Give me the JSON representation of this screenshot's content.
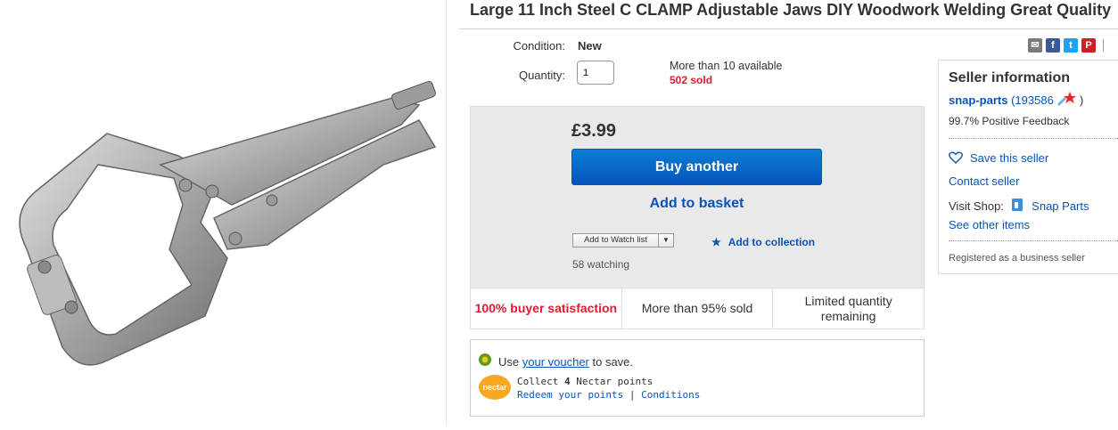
{
  "product": {
    "title": "Large 11 Inch Steel C CLAMP Adjustable Jaws DIY Woodwork Welding Great Quality"
  },
  "details": {
    "condition_label": "Condition:",
    "condition_value": "New",
    "quantity_label": "Quantity:",
    "quantity_value": "1",
    "availability": "More than 10 available",
    "sold": "502 sold"
  },
  "buybox": {
    "price": "£3.99",
    "buy_label": "Buy another",
    "basket_label": "Add to basket",
    "watch_label": "Add to Watch list",
    "collection_label": "Add to collection",
    "watching": "58 watching"
  },
  "stats": {
    "satisfaction": "100% buyer satisfaction",
    "sold_pct": "More than 95% sold",
    "limited": "Limited quantity remaining"
  },
  "voucher": {
    "use": "Use ",
    "link": "your voucher",
    "suffix": " to save.",
    "nectar_logo": "nectar",
    "collect_prefix": "Collect ",
    "points": "4",
    "collect_suffix": " Nectar points",
    "redeem": "Redeem your points",
    "sep": " | ",
    "conditions": "Conditions"
  },
  "seller": {
    "title": "Seller information",
    "name": "snap-parts",
    "rating_open": " (",
    "rating": "193586",
    "rating_close": " )",
    "feedback": "99.7% Positive Feedback",
    "save": "Save this seller",
    "contact": "Contact seller",
    "visit_label": "Visit Shop:",
    "shop_name": "Snap Parts",
    "other_items": "See other items",
    "registered": "Registered as a business seller"
  },
  "share": {
    "icons": [
      "mail-icon",
      "facebook-icon",
      "twitter-icon",
      "pinterest-icon"
    ],
    "colors": {
      "mail": "#7a7a7a",
      "facebook": "#3b5998",
      "twitter": "#1da1f2",
      "pinterest": "#cb2027"
    }
  },
  "colors": {
    "link": "#0654ba",
    "sold": "#dd1e31",
    "buy_button": "#0654ba"
  }
}
